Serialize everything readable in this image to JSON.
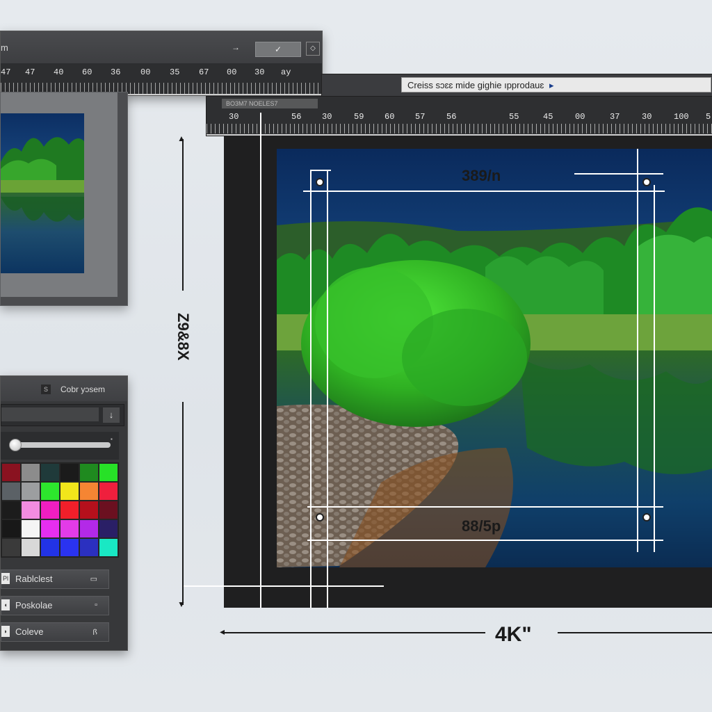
{
  "top_panel": {
    "header_label": "m",
    "arrow_glyph": "→",
    "ok_glyph": "✓",
    "ruler_ticks": [
      "47",
      "47",
      "40",
      "60",
      "36",
      "00",
      "35",
      "67",
      "00",
      "30",
      "ay"
    ]
  },
  "document": {
    "title": "Creiss sɔɛɛ mide gighie ıpprodauɛ",
    "title_glyph": "▸",
    "mini_field": "BO3M7 NOELES7",
    "ruler_ticks": [
      "30",
      "56",
      "30",
      "59",
      "60",
      "57",
      "56",
      "55",
      "45",
      "00",
      "37",
      "30",
      "100",
      "5"
    ],
    "top_dimension": "389/n",
    "bottom_dimension": "88/5p",
    "height_label": "Z9&8X",
    "width_label": "4K\""
  },
  "color_panel": {
    "icon_glyph": "S",
    "title": "Cobr yɔsem",
    "dropdown_glyph": "↓",
    "swatches": [
      "#8a1220",
      "#8c8c8c",
      "#1f3a3a",
      "#1b1b1b",
      "#1f8a1f",
      "#27e127",
      "#5b6166",
      "#9c9ea0",
      "#2de62d",
      "#f2e61b",
      "#f58533",
      "#ef1f3d",
      "#1c1c1c",
      "#f28ce0",
      "#f01ec0",
      "#f01f2a",
      "#b5101c",
      "#6b1020",
      "#181818",
      "#f5f5f5",
      "#e62ef0",
      "#e33be8",
      "#b329e8",
      "#2a1f66",
      "#3a3a3a",
      "#d8d8d8",
      "#2233e6",
      "#2a33f0",
      "#2b30c0",
      "#19e8c4"
    ],
    "layers": [
      {
        "label": "Rablclest",
        "icon": "Pl",
        "right": "▭"
      },
      {
        "label": "Poskolae",
        "icon": "◖",
        "right": "▫"
      },
      {
        "label": "Coleve",
        "icon": "◗",
        "right": "ꟗ"
      }
    ]
  }
}
